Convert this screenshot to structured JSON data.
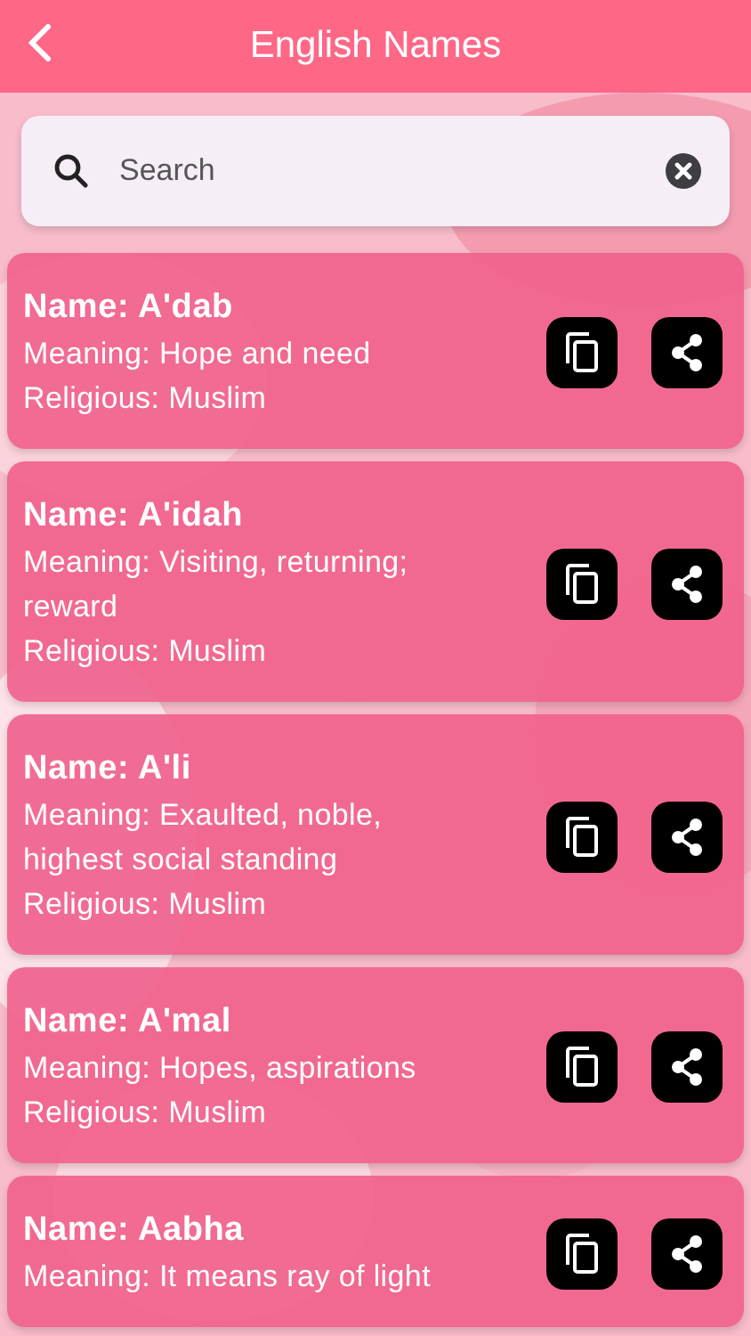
{
  "header": {
    "title": "English Names"
  },
  "search": {
    "placeholder": "Search"
  },
  "names": [
    {
      "name": "Name: A'dab",
      "meaning": "Meaning: Hope and need",
      "religion": "Religious: Muslim"
    },
    {
      "name": "Name: A'idah",
      "meaning": "Meaning: Visiting, returning; reward",
      "religion": "Religious: Muslim"
    },
    {
      "name": "Name: A'li",
      "meaning": "Meaning: Exaulted, noble, highest social standing",
      "religion": "Religious: Muslim"
    },
    {
      "name": "Name: A'mal",
      "meaning": "Meaning: Hopes, aspirations",
      "religion": "Religious: Muslim"
    },
    {
      "name": "Name: Aabha",
      "meaning": "Meaning: It means ray of light"
    }
  ]
}
